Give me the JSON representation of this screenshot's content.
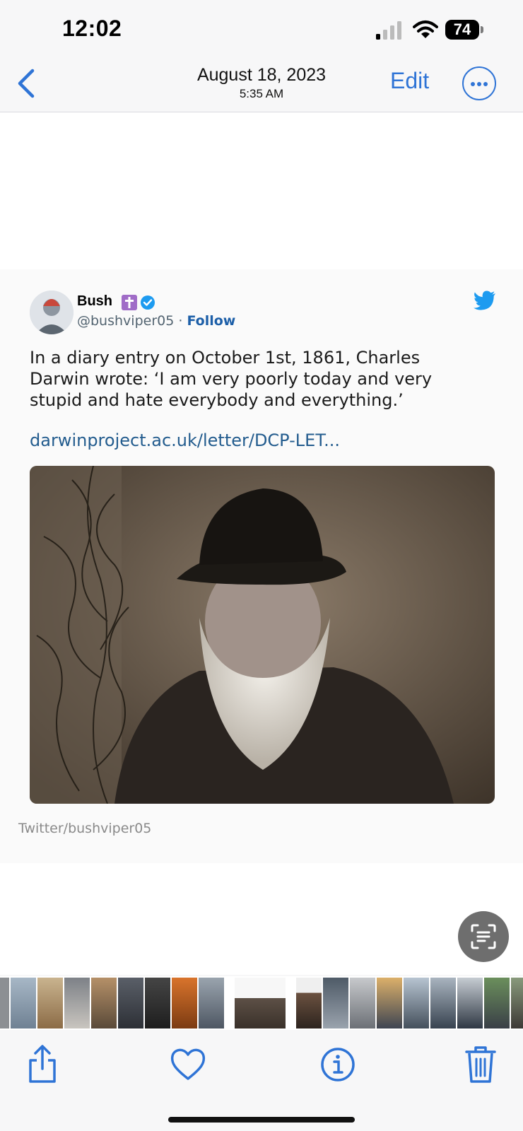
{
  "status_bar": {
    "time": "12:02",
    "battery": "74"
  },
  "nav": {
    "date": "August 18, 2023",
    "time": "5:35 AM",
    "edit_label": "Edit"
  },
  "tweet": {
    "username": "Bush",
    "handle": "@bushviper05",
    "separator": " · ",
    "follow_label": "Follow",
    "text": "In a diary entry on October 1st, 1861, Charles Darwin wrote: ‘I am very poorly today and very stupid and hate everybody and everything.’",
    "link": "darwinproject.ac.uk/letter/DCP-LET...",
    "source": "Twitter/bushviper05"
  },
  "colors": {
    "accent": "#2f74d6",
    "twitter_blue": "#1d9bf0",
    "link": "#235c8e",
    "badge_purple": "#a06cc7"
  },
  "icons": {
    "nav": [
      "chevron-left-icon",
      "more-icon"
    ],
    "toolbar": [
      "share-icon",
      "heart-icon",
      "info-icon",
      "trash-icon"
    ],
    "tweet": [
      "cross-icon",
      "verified-icon",
      "twitter-bird-icon",
      "live-text-icon"
    ]
  }
}
